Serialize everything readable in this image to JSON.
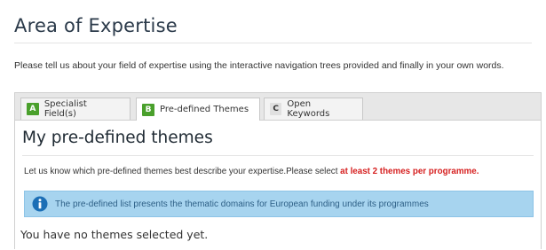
{
  "page": {
    "title": "Area of Expertise",
    "intro": "Please tell us about your field of expertise using the interactive navigation trees provided and finally in your own words."
  },
  "tabs": [
    {
      "letter": "A",
      "label": "Specialist Field(s)",
      "active": false
    },
    {
      "letter": "B",
      "label": "Pre-defined Themes",
      "active": true
    },
    {
      "letter": "C",
      "label": "Open Keywords",
      "active": false
    }
  ],
  "section": {
    "title": "My pre-defined themes",
    "instruction": "Let us know which pre-defined themes best describe your expertise.Please select ",
    "instruction_highlight": "at least 2 themes per programme.",
    "info_text": "The pre-defined list presents the thematic domains for European funding under its programmes",
    "empty_message": "You have no themes selected yet."
  },
  "colors": {
    "tab_badge_green": "#4aa02c",
    "info_background": "#a7d4ef",
    "highlight_red": "#d62020"
  },
  "icons": {
    "info": "info-circle-icon"
  }
}
